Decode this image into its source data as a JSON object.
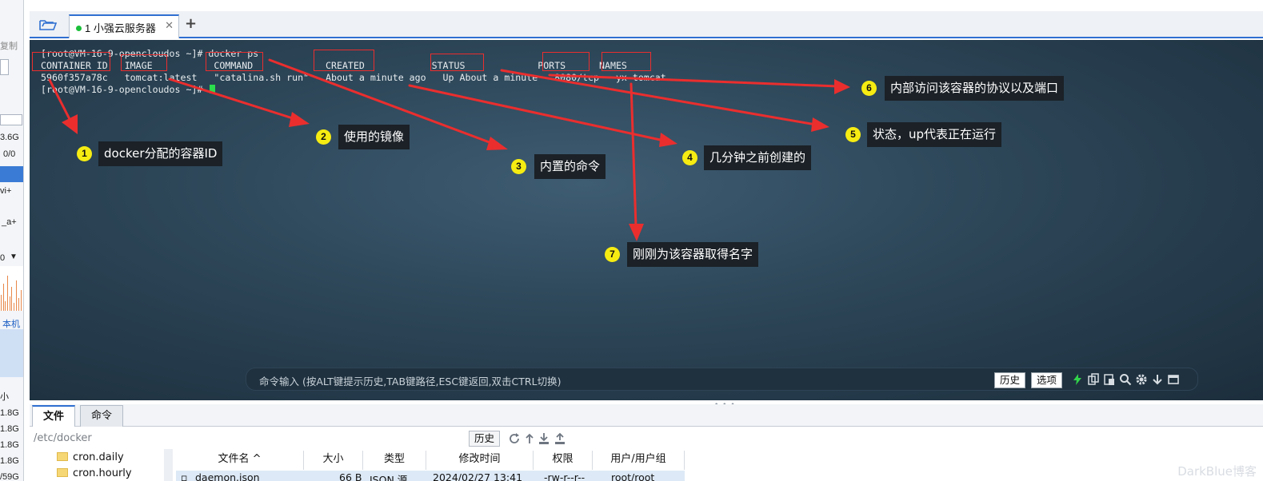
{
  "sidebar": {
    "copy_label": "复制",
    "mem_value": "3.6G",
    "swap_value": "0/0",
    "proc1": "vi+",
    "proc2": "_a+",
    "interface_value": "0",
    "local_label": "本机",
    "size_header": "小",
    "disk_sizes": [
      "1.8G",
      "1.8G",
      "1.8G",
      "1.8G",
      "/59G"
    ]
  },
  "tabs": [
    {
      "label": "1  小强云服务器",
      "status_color": "#1bbf3a"
    }
  ],
  "terminal": {
    "lines": [
      "[root@VM-16-9-opencloudos ~]# docker ps",
      "CONTAINER ID   IMAGE           COMMAND             CREATED            STATUS             PORTS      NAMES",
      "5960f357a78c   tomcat:latest   \"catalina.sh run\"   About a minute ago   Up About a minute   8080/tcp   yx-tomcat",
      "[root@VM-16-9-opencloudos ~]# "
    ]
  },
  "annotations": [
    {
      "number": "1",
      "label": "docker分配的容器ID"
    },
    {
      "number": "2",
      "label": "使用的镜像"
    },
    {
      "number": "3",
      "label": "内置的命令"
    },
    {
      "number": "4",
      "label": "几分钟之前创建的"
    },
    {
      "number": "5",
      "label": "状态，up代表正在运行"
    },
    {
      "number": "6",
      "label": "内部访问该容器的协议以及端口"
    },
    {
      "number": "7",
      "label": "刚刚为该容器取得名字"
    }
  ],
  "command_bar": {
    "placeholder": "命令输入 (按ALT键提示历史,TAB键路径,ESC键返回,双击CTRL切换)",
    "history_label": "历史",
    "options_label": "选项"
  },
  "bottom_tabs": [
    {
      "label": "文件",
      "active": true
    },
    {
      "label": "命令",
      "active": false
    }
  ],
  "file_panel": {
    "path": "/etc/docker",
    "history_label": "历史",
    "tree": [
      "cron.daily",
      "cron.hourly"
    ],
    "columns": [
      "文件名 ^",
      "大小",
      "类型",
      "修改时间",
      "权限",
      "用户/用户组"
    ],
    "rows": [
      {
        "name": "daemon.json",
        "size": "66 B",
        "type": "JSON 源",
        "modified": "2024/02/27 13:41",
        "perms": "-rw-r--r--",
        "owner": "root/root"
      }
    ]
  },
  "watermark": "DarkBlue博客"
}
